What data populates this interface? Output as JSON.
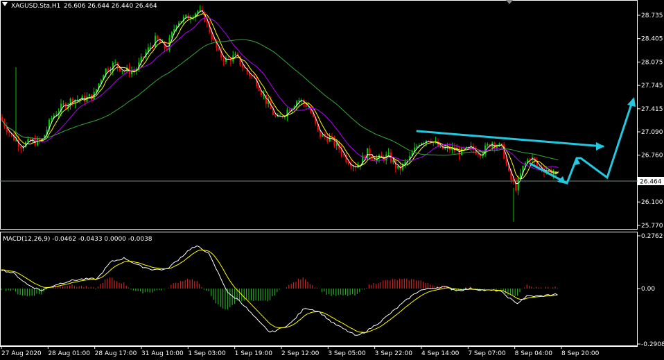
{
  "chart_data": [
    {
      "type": "candlestick",
      "symbol_header": "XAGUSD.Sta,H1",
      "ohlc_header": "26.606 26.644 26.440 26.464",
      "open": 26.606,
      "high": 26.644,
      "low": 26.44,
      "close": 26.464,
      "current_price_label": "26.464",
      "current_price": 26.464,
      "y_ticks": [
        "28.735",
        "28.405",
        "28.075",
        "27.745",
        "27.415",
        "27.090",
        "26.760",
        "26.464",
        "26.100",
        "25.770"
      ],
      "ylim": [
        25.72,
        28.95
      ],
      "approx_path": [
        [
          0,
          27.3
        ],
        [
          15,
          27.05
        ],
        [
          30,
          26.9
        ],
        [
          45,
          26.95
        ],
        [
          60,
          26.95
        ],
        [
          75,
          27.3
        ],
        [
          90,
          27.45
        ],
        [
          105,
          27.55
        ],
        [
          120,
          27.55
        ],
        [
          135,
          27.6
        ],
        [
          150,
          27.95
        ],
        [
          165,
          28.05
        ],
        [
          180,
          27.95
        ],
        [
          195,
          27.95
        ],
        [
          210,
          28.2
        ],
        [
          225,
          28.4
        ],
        [
          240,
          28.25
        ],
        [
          255,
          28.65
        ],
        [
          270,
          28.7
        ],
        [
          285,
          28.8
        ],
        [
          295,
          28.7
        ],
        [
          305,
          28.45
        ],
        [
          315,
          28.2
        ],
        [
          325,
          28.1
        ],
        [
          340,
          28.15
        ],
        [
          355,
          27.95
        ],
        [
          370,
          27.8
        ],
        [
          385,
          27.5
        ],
        [
          400,
          27.25
        ],
        [
          415,
          27.4
        ],
        [
          430,
          27.55
        ],
        [
          445,
          27.45
        ],
        [
          460,
          27.05
        ],
        [
          475,
          27.0
        ],
        [
          490,
          26.85
        ],
        [
          500,
          26.7
        ],
        [
          515,
          26.6
        ],
        [
          530,
          26.8
        ],
        [
          545,
          26.7
        ],
        [
          560,
          26.75
        ],
        [
          575,
          26.55
        ],
        [
          590,
          26.7
        ],
        [
          605,
          26.95
        ],
        [
          620,
          27.0
        ],
        [
          635,
          26.85
        ],
        [
          650,
          26.85
        ],
        [
          665,
          26.8
        ],
        [
          680,
          26.85
        ],
        [
          695,
          26.8
        ],
        [
          710,
          26.95
        ],
        [
          725,
          26.85
        ],
        [
          735,
          26.45
        ],
        [
          745,
          26.3
        ],
        [
          755,
          26.6
        ],
        [
          765,
          26.75
        ],
        [
          775,
          26.6
        ],
        [
          790,
          26.55
        ],
        [
          805,
          26.46
        ]
      ],
      "annotations": "cyan arrows (projection)"
    },
    {
      "type": "histogram+line",
      "header": "MACD(12,26,9) -0.0462 -0.0433 0.0000 -0.0038",
      "y_ticks": [
        "0.2762",
        "0.00",
        "-0.2908"
      ],
      "ylim": [
        -0.2908,
        0.2762
      ],
      "approx_path": [
        [
          0,
          0.1
        ],
        [
          20,
          0.08
        ],
        [
          40,
          0.02
        ],
        [
          60,
          -0.01
        ],
        [
          80,
          0.02
        ],
        [
          100,
          0.04
        ],
        [
          120,
          0.05
        ],
        [
          140,
          0.05
        ],
        [
          160,
          0.14
        ],
        [
          180,
          0.16
        ],
        [
          200,
          0.12
        ],
        [
          220,
          0.1
        ],
        [
          240,
          0.1
        ],
        [
          260,
          0.16
        ],
        [
          275,
          0.21
        ],
        [
          285,
          0.22
        ],
        [
          300,
          0.19
        ],
        [
          315,
          0.08
        ],
        [
          330,
          -0.03
        ],
        [
          345,
          -0.06
        ],
        [
          360,
          -0.12
        ],
        [
          375,
          -0.18
        ],
        [
          390,
          -0.23
        ],
        [
          405,
          -0.21
        ],
        [
          420,
          -0.18
        ],
        [
          440,
          -0.1
        ],
        [
          460,
          -0.12
        ],
        [
          480,
          -0.18
        ],
        [
          500,
          -0.22
        ],
        [
          515,
          -0.25
        ],
        [
          530,
          -0.22
        ],
        [
          550,
          -0.17
        ],
        [
          570,
          -0.11
        ],
        [
          590,
          -0.05
        ],
        [
          605,
          -0.01
        ],
        [
          620,
          0.0
        ],
        [
          640,
          0.01
        ],
        [
          660,
          -0.01
        ],
        [
          680,
          0.0
        ],
        [
          700,
          -0.01
        ],
        [
          720,
          -0.01
        ],
        [
          735,
          -0.05
        ],
        [
          745,
          -0.08
        ],
        [
          760,
          -0.04
        ],
        [
          780,
          -0.04
        ],
        [
          800,
          -0.03
        ]
      ]
    }
  ],
  "x_ticks": [
    "27 Aug 2020",
    "28 Aug 01:00",
    "28 Aug 17:00",
    "31 Aug 10:00",
    "1 Sep 03:00",
    "1 Sep 19:00",
    "2 Sep 12:00",
    "3 Sep 05:00",
    "3 Sep 22:00",
    "4 Sep 14:00",
    "7 Sep 07:00",
    "8 Sep 04:00",
    "8 Sep 20:00"
  ],
  "colors": {
    "bull": "#00cc00",
    "bear": "#ff0000",
    "arrow": "#22c8e0",
    "ma_fast": "#ffffff",
    "ma_mid": "#ffff00",
    "ma_slow": "#b000ff",
    "ma_long": "#33aa33",
    "macd_pos": "#cc2222",
    "macd_neg": "#22aa22",
    "macd_main": "#ffffff",
    "macd_signal": "#ffff00",
    "axis": "#ffffff",
    "price_line": "#6f8f7f"
  }
}
